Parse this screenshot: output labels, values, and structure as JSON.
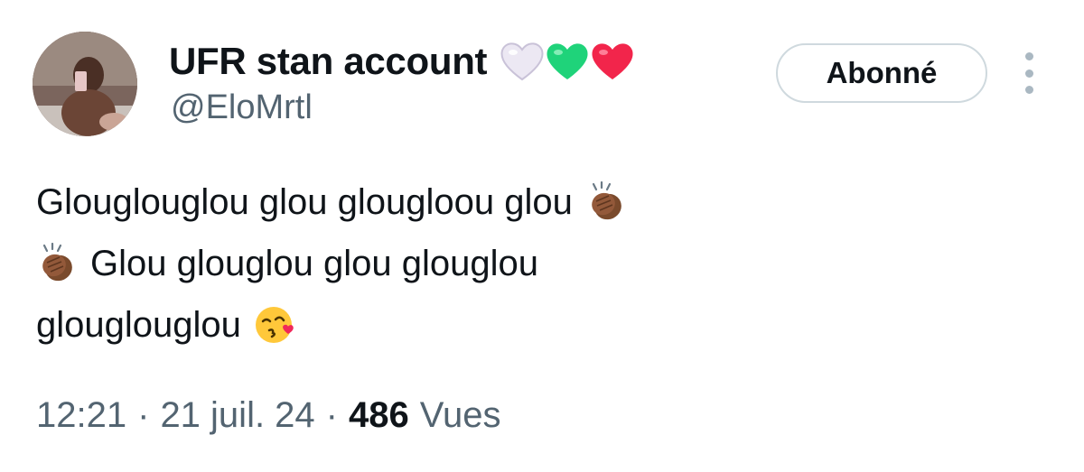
{
  "author": {
    "display_name": "UFR stan account",
    "handle": "@EloMrtl",
    "name_emojis": [
      "white-heart-icon",
      "green-heart-icon",
      "red-heart-icon"
    ],
    "avatar": "profile-photo"
  },
  "follow_button": {
    "label": "Abonné"
  },
  "more_menu": {
    "icon": "more-vertical-icon"
  },
  "tweet": {
    "lines": [
      {
        "text": "Glouglouglou glou glougloou glou",
        "emoji_after": "clapping-hands-icon"
      },
      {
        "emoji_before": "clapping-hands-icon",
        "text": "Glou glouglou glou glouglou"
      },
      {
        "text": "glouglouglou",
        "emoji_after": "kissing-face-icon"
      }
    ]
  },
  "meta": {
    "time": "12:21",
    "separator": "·",
    "date": "21 juil. 24",
    "views_count": "486",
    "views_label": "Vues"
  },
  "colors": {
    "text_primary": "#0f1419",
    "text_secondary": "#536471",
    "button_border": "#cfd9de",
    "white_heart": "#e9e4f2",
    "green_heart": "#1fd37a",
    "red_heart": "#f2254b"
  }
}
